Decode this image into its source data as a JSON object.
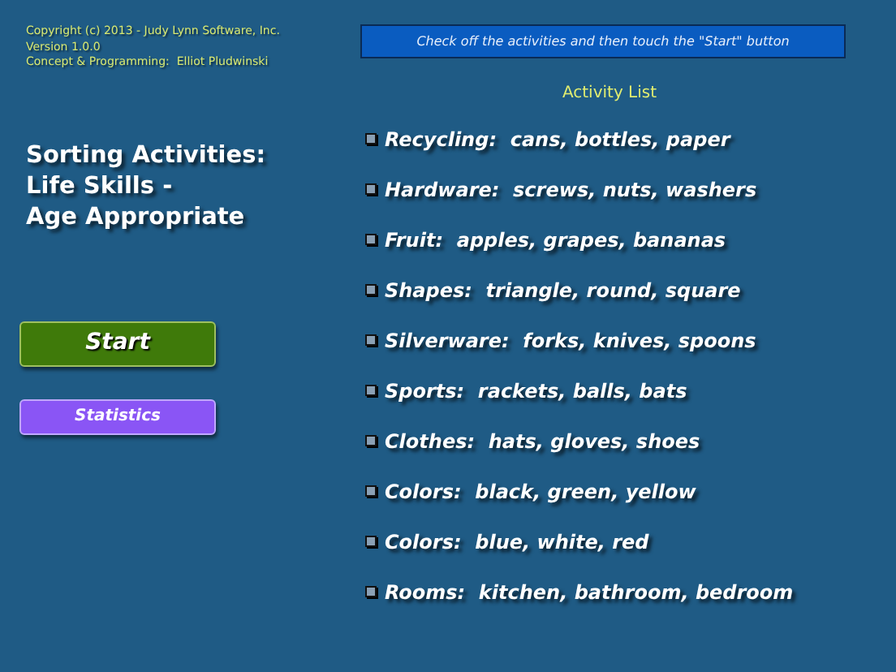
{
  "credits": [
    "Copyright (c) 2013 - Judy Lynn Software, Inc.",
    "Version 1.0.0",
    "Concept & Programming:  Elliot Pludwinski"
  ],
  "title": [
    "Sorting Activities:",
    "Life Skills -",
    "Age Appropriate"
  ],
  "buttons": [
    {
      "kind": "start",
      "label": "Start"
    },
    {
      "kind": "stats",
      "label": "Statistics"
    }
  ],
  "instruction": "Check off the activities and then touch the \"Start\" button",
  "list_heading": "Activity List",
  "activities": [
    {
      "label": "Recycling:  cans, bottles, paper",
      "checked": false
    },
    {
      "label": "Hardware:  screws, nuts, washers",
      "checked": false
    },
    {
      "label": "Fruit:  apples, grapes, bananas",
      "checked": false
    },
    {
      "label": "Shapes:  triangle, round, square",
      "checked": false
    },
    {
      "label": "Silverware:  forks, knives, spoons",
      "checked": false
    },
    {
      "label": "Sports:  rackets, balls, bats",
      "checked": false
    },
    {
      "label": "Clothes:  hats, gloves, shoes",
      "checked": false
    },
    {
      "label": "Colors:  black, green, yellow",
      "checked": false
    },
    {
      "label": "Colors:  blue, white, red",
      "checked": false
    },
    {
      "label": "Rooms:  kitchen, bathroom, bedroom",
      "checked": false
    }
  ]
}
